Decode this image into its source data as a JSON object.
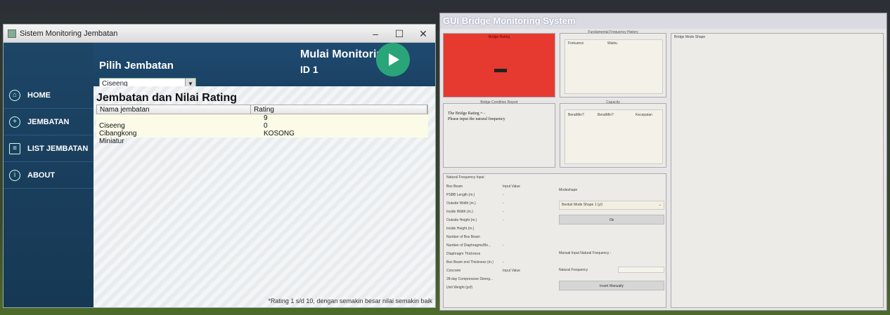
{
  "left_window": {
    "title": "Sistem Monitoring Jembatan",
    "controls": {
      "minimize": "–",
      "maximize": "☐",
      "close": "✕"
    },
    "sidebar": {
      "items": [
        {
          "label": "HOME",
          "icon": "home-icon"
        },
        {
          "label": "JEMBATAN",
          "icon": "plus-circle-icon"
        },
        {
          "label": "LIST JEMBATAN",
          "icon": "list-icon"
        },
        {
          "label": "ABOUT",
          "icon": "info-icon"
        }
      ]
    },
    "header": {
      "pilih_label": "Pilih Jembatan",
      "selected_bridge": "Ciseeng",
      "monitor_label": "Mulai Monitoring",
      "id_label": "ID 1"
    },
    "content": {
      "title": "Jembatan dan Nilai Rating",
      "table": {
        "columns": [
          "Nama jembatan",
          "Rating"
        ],
        "rows": [
          [
            "",
            "9"
          ],
          [
            "Ciseeng",
            "0"
          ],
          [
            "Cibangkong",
            "KOSONG"
          ],
          [
            "Miniatur",
            ""
          ]
        ]
      },
      "note": "*Rating 1 s/d 10, dengan semakin besar nilai semakin baik"
    }
  },
  "right_window": {
    "title": "GUI Bridge Monitoring System",
    "bridge_rating_label": "Bridge Rating",
    "fund_freq_label": "Fundamental Frequency History",
    "fund_freq_cols": [
      "Frekuensi",
      "Waktu"
    ],
    "mode_shape_label": "Bridge Mode Shape",
    "condition_label": "Bridge Condition Report",
    "condition_lines": [
      "The Bridge Rating = -",
      "Please input the natural frequency"
    ],
    "capacity_label": "Capacity",
    "capacity_cols": [
      "BeratMin?",
      "BeratMin?",
      "Kecepatan"
    ],
    "nf_label": "Natural Frequency Input",
    "nf_rows": [
      [
        "Box Beam",
        "Input Value"
      ],
      [
        "PSBB Length (m.)",
        "-"
      ],
      [
        "Outside Width (m.)",
        "-"
      ],
      [
        "Inside Width (m.)",
        "-"
      ],
      [
        "Outside Height (m.)",
        "-"
      ],
      [
        "Inside Height (m.)",
        ""
      ],
      [
        "Number of Box Beam",
        ""
      ],
      [
        "Number of Diaphragms/Bo...",
        "-"
      ],
      [
        "Diaphragm Thickness",
        ""
      ],
      [
        "Box Beam end Thickness (m.)",
        "-"
      ],
      [
        "Concrete",
        "Input Value"
      ],
      [
        "28-day Compressive Streng...",
        ""
      ],
      [
        "Unit Weight (pcf)",
        ""
      ]
    ],
    "modeshape_label": "Modeshape",
    "modeshape_select": "Bentuk Mode Shape 1 (y/)",
    "ok_label": "Ok",
    "manual_label": "Manual Input Natural Frequency :",
    "nat_freq_label": "Natural Frequency",
    "insert_label": "Insert Manually"
  }
}
